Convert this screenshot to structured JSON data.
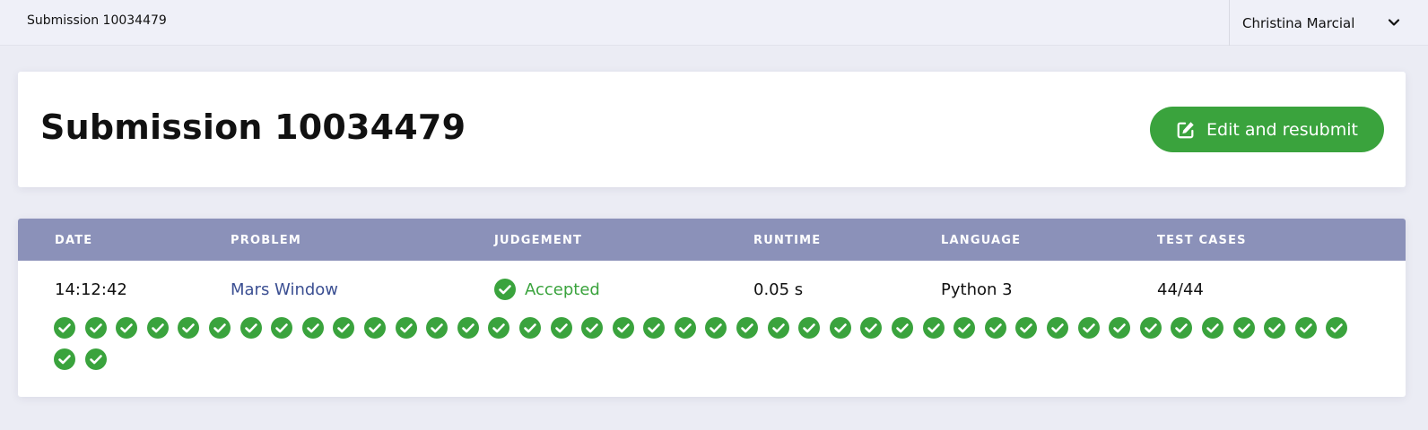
{
  "topbar": {
    "breadcrumb": "Submission 10034479",
    "user_name": "Christina Marcial"
  },
  "header": {
    "title": "Submission 10034479",
    "resubmit_label": "Edit and resubmit"
  },
  "table": {
    "columns": [
      "DATE",
      "PROBLEM",
      "JUDGEMENT",
      "RUNTIME",
      "LANGUAGE",
      "TEST CASES"
    ],
    "row": {
      "date": "14:12:42",
      "problem": "Mars Window",
      "judgement": "Accepted",
      "runtime": "0.05 s",
      "language": "Python 3",
      "test_cases": "44/44"
    },
    "test_results_passed": 44,
    "test_results_total": 44
  },
  "colors": {
    "accent_green": "#3aa33d",
    "table_header": "#8b91b9",
    "link": "#3b4f92"
  }
}
